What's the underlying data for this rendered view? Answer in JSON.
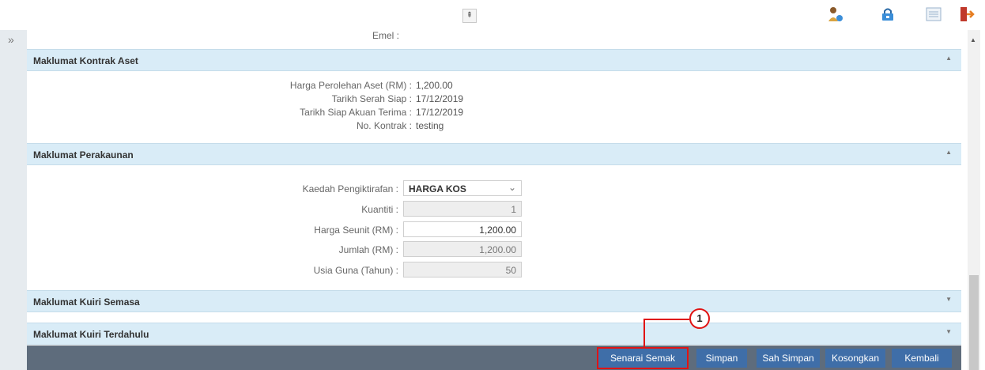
{
  "topbar": {
    "collapse_glyph": "⇞",
    "icons": [
      "user-help-icon",
      "lock-icon",
      "list-icon",
      "logout-icon"
    ]
  },
  "rail": {
    "expand_glyph": "»"
  },
  "prev_field": {
    "label": "Emel :"
  },
  "sections": {
    "kontrak": {
      "title": "Maklumat Kontrak Aset",
      "fields": [
        {
          "label": "Harga Perolehan Aset (RM) :",
          "value": "1,200.00"
        },
        {
          "label": "Tarikh Serah Siap :",
          "value": "17/12/2019"
        },
        {
          "label": "Tarikh Siap Akuan Terima :",
          "value": "17/12/2019"
        },
        {
          "label": "No. Kontrak :",
          "value": "testing"
        }
      ]
    },
    "perakaunan": {
      "title": "Maklumat Perakaunan",
      "kaedah": {
        "label": "Kaedah Pengiktirafan :",
        "value": "HARGA KOS"
      },
      "kuantiti": {
        "label": "Kuantiti :",
        "value": "1"
      },
      "harga_seunit": {
        "label": "Harga Seunit (RM) :",
        "value": "1,200.00"
      },
      "jumlah": {
        "label": "Jumlah (RM) :",
        "value": "1,200.00"
      },
      "usia_guna": {
        "label": "Usia Guna (Tahun) :",
        "value": "50"
      }
    },
    "kuiri_semasa": {
      "title": "Maklumat Kuiri Semasa"
    },
    "kuiri_terdahulu": {
      "title": "Maklumat Kuiri Terdahulu"
    }
  },
  "buttons": {
    "senarai_semak": "Senarai Semak",
    "simpan": "Simpan",
    "sah_simpan": "Sah Simpan",
    "kosongkan": "Kosongkan",
    "kembali": "Kembali"
  },
  "callout": {
    "number": "1"
  },
  "colors": {
    "section_header": "#d9ecf7",
    "button": "#3f6ea8",
    "footer": "#5e6c7c",
    "highlight": "#e01414"
  }
}
